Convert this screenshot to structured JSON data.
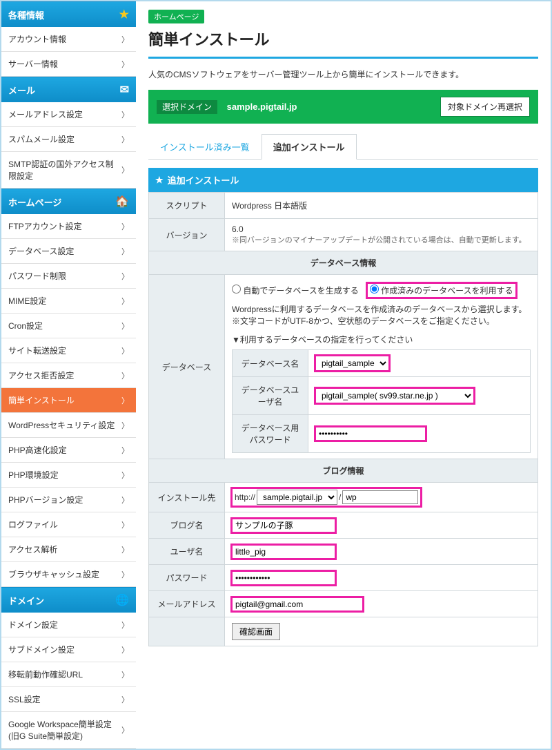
{
  "sidebar": {
    "groups": [
      {
        "title": "各種情報",
        "icon": "★",
        "iconColor": "#f8c81e",
        "items": [
          "アカウント情報",
          "サーバー情報"
        ]
      },
      {
        "title": "メール",
        "icon": "✉",
        "iconColor": "#fff",
        "items": [
          "メールアドレス設定",
          "スパムメール設定",
          "SMTP認証の国外アクセス制限設定"
        ]
      },
      {
        "title": "ホームページ",
        "icon": "🏠",
        "iconColor": "#f8a81e",
        "items": [
          "FTPアカウント設定",
          "データベース設定",
          "パスワード制限",
          "MIME設定",
          "Cron設定",
          "サイト転送設定",
          "アクセス拒否設定",
          "簡単インストール",
          "WordPressセキュリティ設定",
          "PHP高速化設定",
          "PHP環境設定",
          "PHPバージョン設定",
          "ログファイル",
          "アクセス解析",
          "ブラウザキャッシュ設定"
        ],
        "activeIndex": 7
      },
      {
        "title": "ドメイン",
        "icon": "🌐",
        "iconColor": "#6de07a",
        "items": [
          "ドメイン設定",
          "サブドメイン設定",
          "移転前動作確認URL",
          "SSL設定",
          "Google Workspace簡単設定\n(旧G Suite簡単設定)"
        ]
      }
    ]
  },
  "crumb": "ホームページ",
  "pageTitle": "簡単インストール",
  "description": "人気のCMSソフトウェアをサーバー管理ツール上から簡単にインストールできます。",
  "domainBar": {
    "label": "選択ドメイン",
    "domain": "sample.pigtail.jp",
    "button": "対象ドメイン再選択"
  },
  "tabs": [
    {
      "label": "インストール済み一覧",
      "active": false
    },
    {
      "label": "追加インストール",
      "active": true
    }
  ],
  "panelTitle": "追加インストール",
  "form": {
    "scriptLabel": "スクリプト",
    "scriptValue": "Wordpress 日本語版",
    "versionLabel": "バージョン",
    "versionValue": "6.0",
    "versionNote": "※同バージョンのマイナーアップデートが公開されている場合は、自動で更新します。",
    "dbSection": "データベース情報",
    "dbLabel": "データベース",
    "radio1": "自動でデータベースを生成する",
    "radio2": "作成済みのデータベースを利用する",
    "radioSelected": 2,
    "dbHelp1": "Wordpressに利用するデータベースを作成済みのデータベースから選択します。",
    "dbHelp2": "※文字コードがUTF-8かつ、空状態のデータベースをご指定ください。",
    "dbHelp3": "▼利用するデータベースの指定を行ってください",
    "dbNameLabel": "データベース名",
    "dbNameValue": "pigtail_sample",
    "dbUserLabel": "データベースユーザ名",
    "dbUserValue": "pigtail_sample( sv99.star.ne.jp )",
    "dbPassLabel": "データベース用パスワード",
    "dbPassValue": "••••••••••",
    "blogSection": "ブログ情報",
    "installLabel": "インストール先",
    "installPrefix": "http://",
    "installDomain": "sample.pigtail.jp",
    "installPath": "wp",
    "blogNameLabel": "ブログ名",
    "blogNameValue": "サンプルの子豚",
    "userLabel": "ユーザ名",
    "userValue": "little_pig",
    "passLabel": "パスワード",
    "passValue": "••••••••••••",
    "emailLabel": "メールアドレス",
    "emailValue": "pigtail@gmail.com",
    "confirmBtn": "確認画面"
  }
}
